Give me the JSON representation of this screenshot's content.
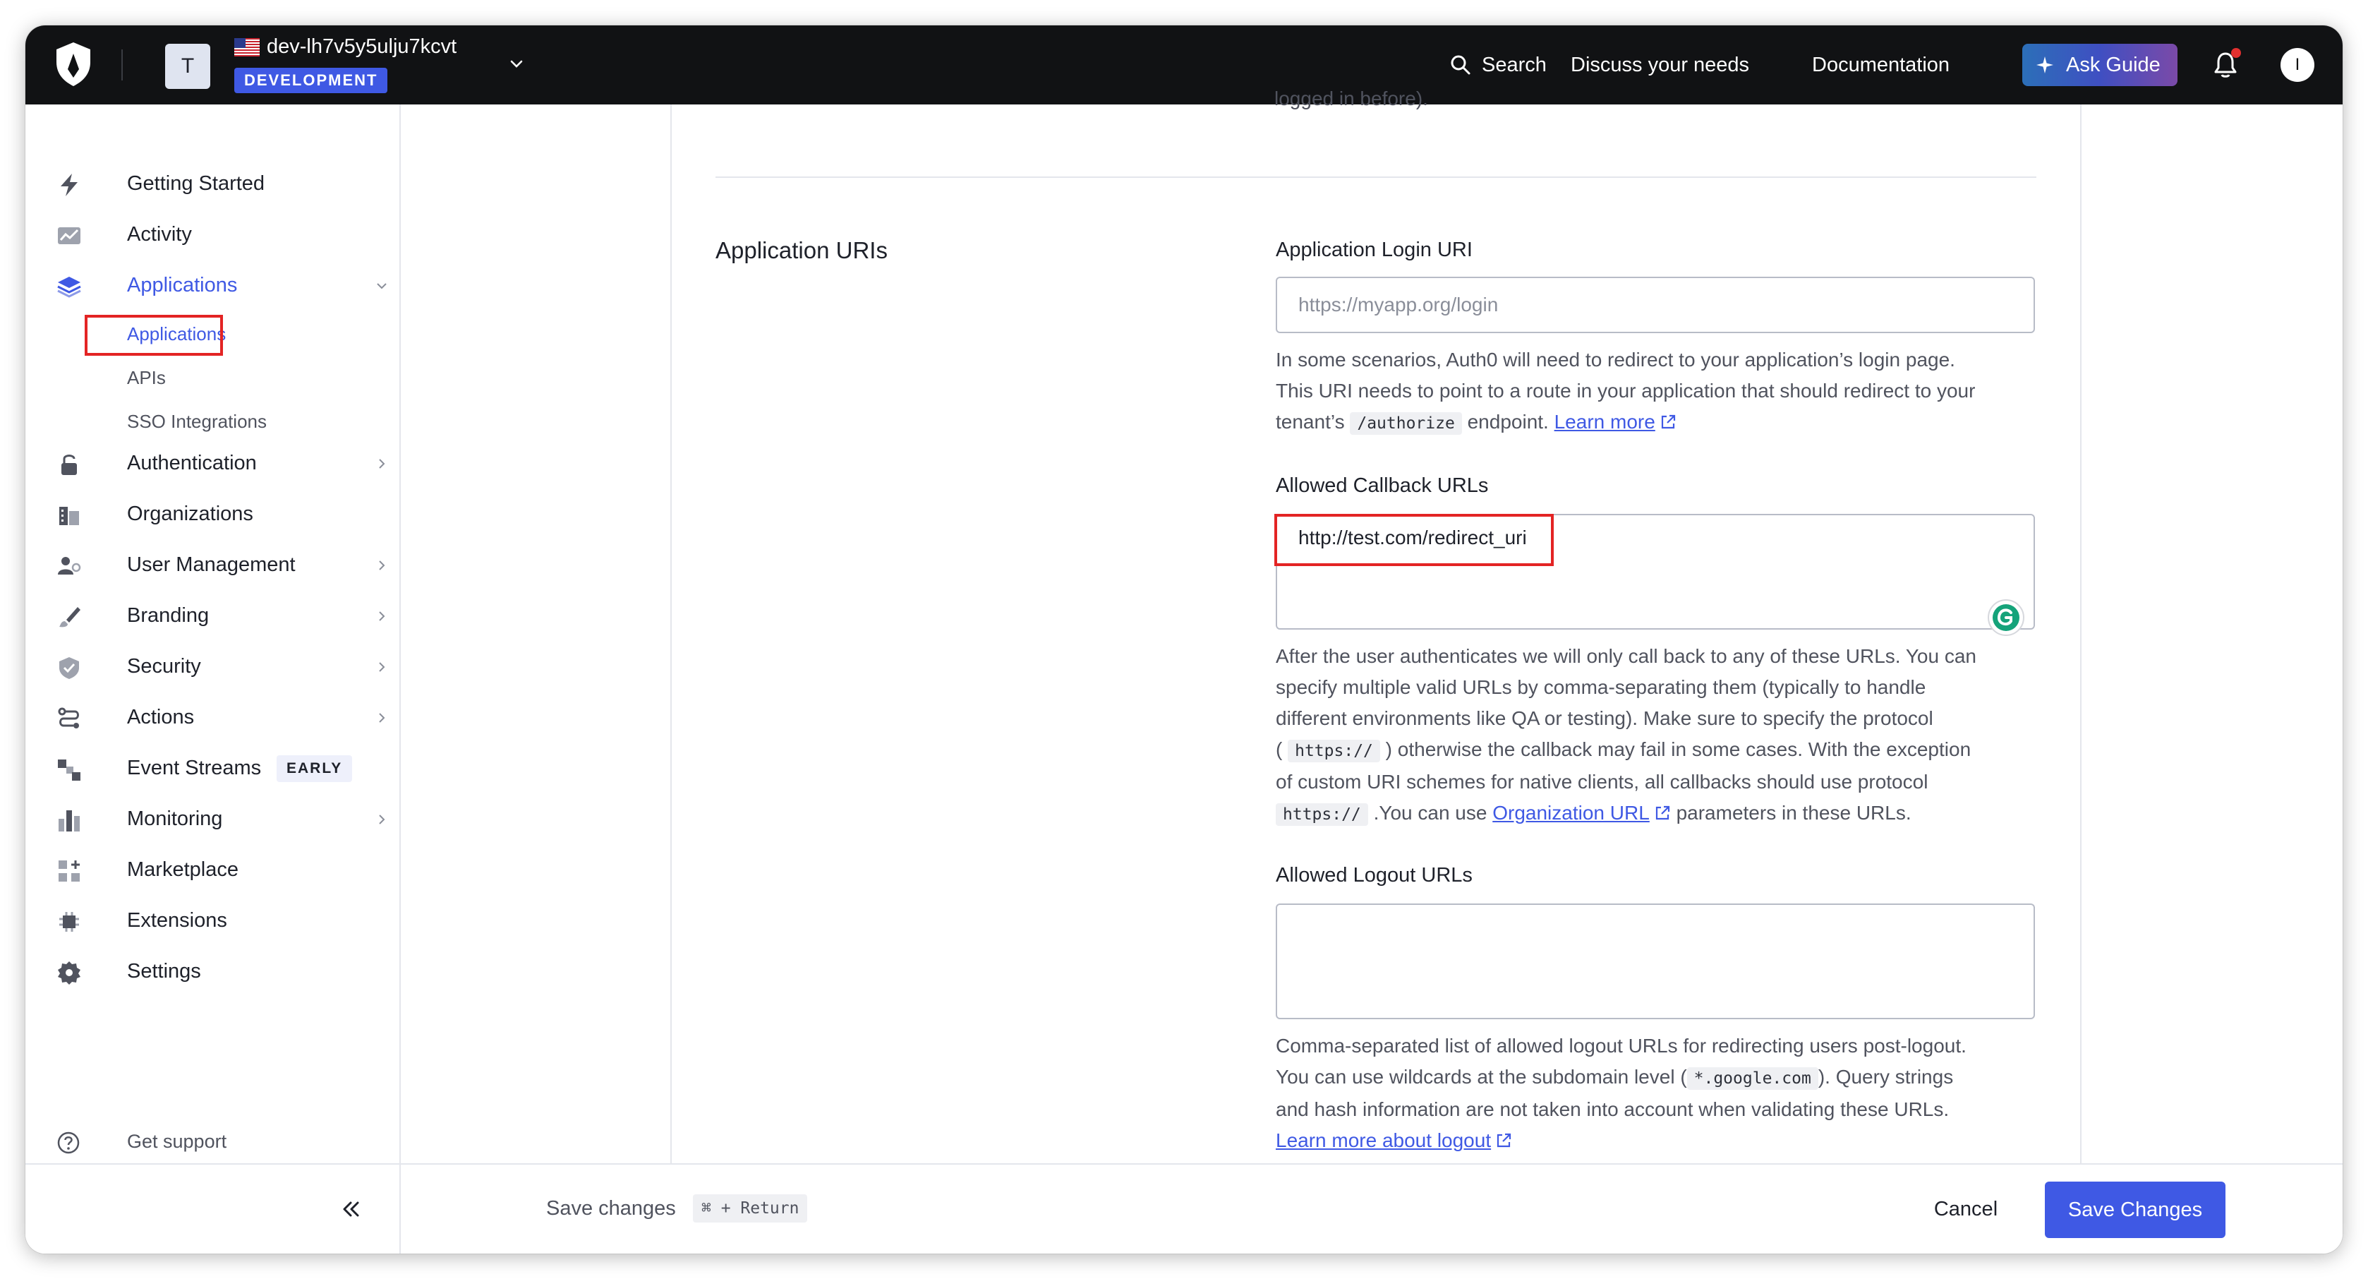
{
  "topbar": {
    "tenant_initial": "T",
    "tenant_name": "dev-lh7v5y5ulju7kcvt",
    "env_badge": "DEVELOPMENT",
    "search_label": "Search",
    "discuss_label": "Discuss your needs",
    "docs_label": "Documentation",
    "ask_guide_label": "Ask Guide",
    "user_initial": "I"
  },
  "sidebar": {
    "getting_started": "Getting Started",
    "activity": "Activity",
    "applications": "Applications",
    "sub": {
      "applications": "Applications",
      "apis": "APIs",
      "sso": "SSO Integrations"
    },
    "authentication": "Authentication",
    "organizations": "Organizations",
    "user_management": "User Management",
    "branding": "Branding",
    "security": "Security",
    "actions": "Actions",
    "event_streams": "Event Streams",
    "early_badge": "EARLY",
    "monitoring": "Monitoring",
    "marketplace": "Marketplace",
    "extensions": "Extensions",
    "settings": "Settings",
    "get_support": "Get support"
  },
  "main": {
    "cut_off_text": "logged in before).",
    "section_title": "Application URIs",
    "login_uri": {
      "label": "Application Login URI",
      "placeholder": "https://myapp.org/login",
      "help_1": "In some scenarios, Auth0 will need to redirect to your application’s login page.",
      "help_2": "This URI needs to point to a route in your application that should redirect to your",
      "help_3a": "tenant’s",
      "help_code": "/authorize",
      "help_3b": "endpoint.",
      "learn_more": "Learn more"
    },
    "callback": {
      "label": "Allowed Callback URLs",
      "value": "http://test.com/redirect_uri",
      "help_1": "After the user authenticates we will only call back to any of these URLs. You can",
      "help_2": "specify multiple valid URLs by comma-separating them (typically to handle",
      "help_3": "different environments like QA or testing). Make sure to specify the protocol",
      "help_4a": "(",
      "help_code1": "https://",
      "help_4b": ") otherwise the callback may fail in some cases. With the exception",
      "help_5": "of custom URI schemes for native clients, all callbacks should use protocol",
      "help_code2": "https://",
      "help_6a": ".You can use",
      "org_link": "Organization URL",
      "help_6b": "parameters in these URLs."
    },
    "logout": {
      "label": "Allowed Logout URLs",
      "value": "",
      "help_1": "Comma-separated list of allowed logout URLs for redirecting users post-logout.",
      "help_2a": "You can use wildcards at the subdomain level (",
      "help_code": "*.google.com",
      "help_2b": "). Query strings",
      "help_3": "and hash information are not taken into account when validating these URLs.",
      "learn_more": "Learn more about logout"
    }
  },
  "footer": {
    "hint": "Save changes",
    "shortcut": "⌘ + Return",
    "cancel": "Cancel",
    "save": "Save Changes"
  },
  "colors": {
    "accent": "#3f59e4",
    "topbar_bg": "#111214",
    "highlight_box": "#e32424"
  }
}
